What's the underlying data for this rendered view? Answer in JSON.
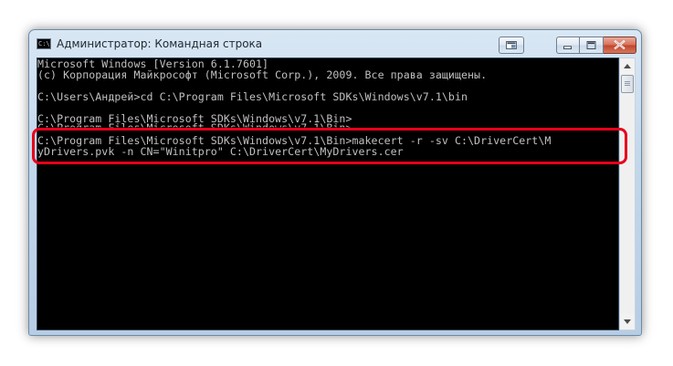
{
  "window": {
    "title": "Администратор: Командная строка",
    "icon": "console-icon",
    "icon_text": "C:\\",
    "buttons": [
      "settings-icon",
      "minimize-icon",
      "maximize-icon",
      "close-icon"
    ]
  },
  "console": {
    "lines": [
      "Microsoft Windows [Version 6.1.7601]",
      "(c) Корпорация Майкрософт (Microsoft Corp.), 2009. Все права защищены.",
      "",
      "C:\\Users\\Андрей>cd C:\\Program Files\\Microsoft SDKs\\Windows\\v7.1\\bin",
      "",
      "C:\\Program Files\\Microsoft SDKs\\Windows\\v7.1\\Bin>",
      "C:\\Program Files\\Microsoft SDKs\\Windows\\v7.1\\Bin>",
      "C:\\Program Files\\Microsoft SDKs\\Windows\\v7.1\\Bin>makecert -r -sv C:\\DriverCert\\M",
      "yDrivers.pvk -n CN=\"Winitpro\" C:\\DriverCert\\MyDrivers.cer"
    ],
    "text_color": "#c0c0c0",
    "background": "#000000"
  },
  "highlight_color": "#e8001c"
}
